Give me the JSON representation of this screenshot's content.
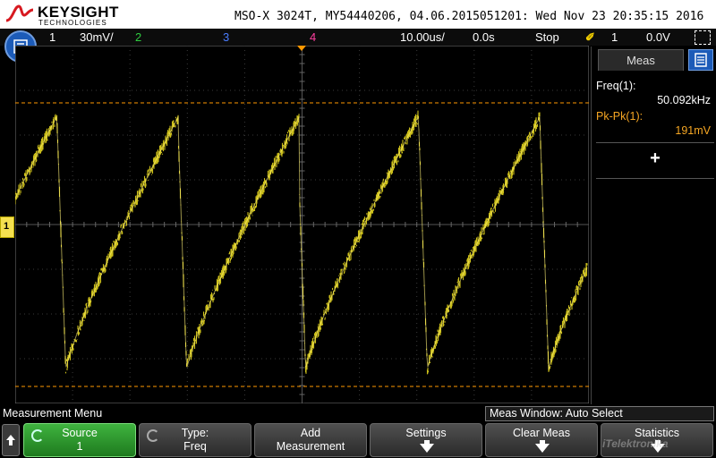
{
  "colors": {
    "ch1": "#f0e020",
    "ch2": "#2ecc40",
    "ch3": "#4a7dff",
    "ch4": "#ff3fa0",
    "cursor": "#ff9900",
    "measure_highlight": "#f5a623",
    "softkey_active": "#2fa12f"
  },
  "header": {
    "brand": "KEYSIGHT",
    "brand_sub": "TECHNOLOGIES",
    "title": "MSO-X 3024T, MY54440206, 04.06.2015051201: Wed Nov 23 20:35:15 2016"
  },
  "status": {
    "ch1_num": "1",
    "ch1_scale": "30mV/",
    "ch2_num": "2",
    "ch3_num": "3",
    "ch4_num": "4",
    "timebase": "10.00us/",
    "delay": "0.0s",
    "run_state": "Stop",
    "trigger_icon": "rising-edge-trigger-icon",
    "trigger_source": "1",
    "trigger_level": "0.0V"
  },
  "waveform": {
    "channel": "1",
    "shape": "noisy-sawtooth",
    "cycles_visible": 4.7
  },
  "screen": {
    "ch1_marker": "1"
  },
  "meas_panel": {
    "tab_label": "Meas",
    "items": [
      {
        "name": "Freq(1):",
        "value": "50.092kHz"
      },
      {
        "name": "Pk-Pk(1):",
        "value": "191mV"
      }
    ],
    "add_label": "+"
  },
  "menu": {
    "title": "Measurement Menu",
    "meas_window": "Meas Window: Auto Select"
  },
  "softkeys": {
    "source": {
      "label": "Source",
      "value": "1"
    },
    "type": {
      "label": "Type:",
      "value": "Freq"
    },
    "add": {
      "label": "Add",
      "value": "Measurement"
    },
    "settings": {
      "label": "Settings"
    },
    "clear": {
      "label": "Clear Meas"
    },
    "stats": {
      "label": "Statistics"
    }
  },
  "watermark": "iTelektronika"
}
